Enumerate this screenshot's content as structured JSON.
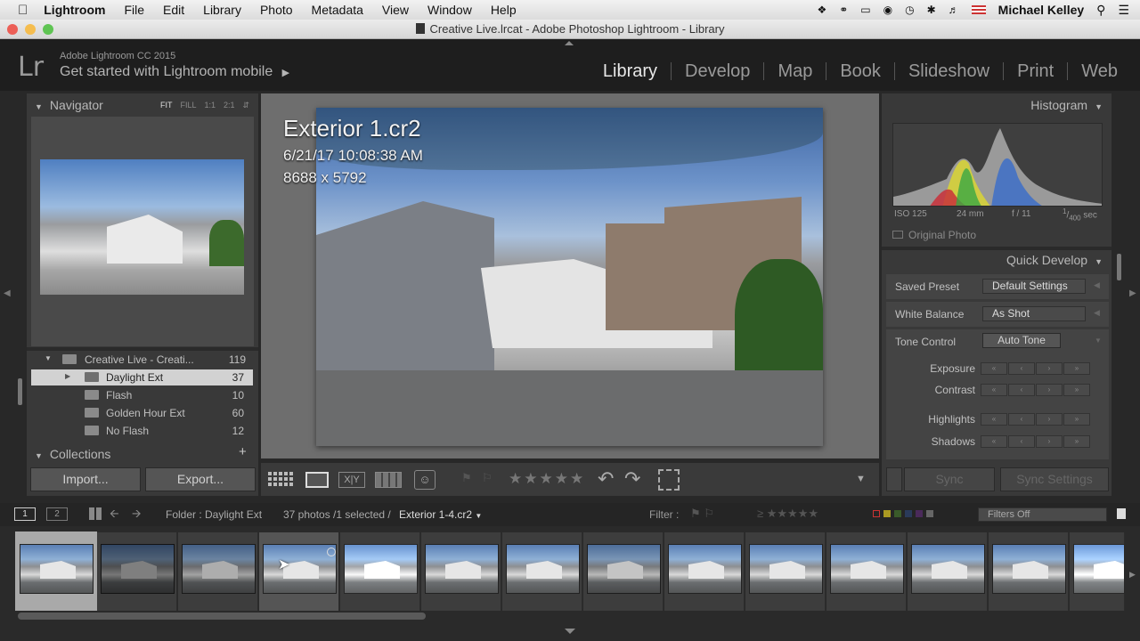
{
  "menubar": {
    "app": "Lightroom",
    "items": [
      "File",
      "Edit",
      "Library",
      "Photo",
      "Metadata",
      "View",
      "Window",
      "Help"
    ],
    "user": "Michael Kelley"
  },
  "window": {
    "title": "Creative Live.lrcat - Adobe Photoshop Lightroom - Library"
  },
  "identity": {
    "logo": "Lr",
    "line1": "Adobe Lightroom CC 2015",
    "line2": "Get started with Lightroom mobile"
  },
  "modules": [
    "Library",
    "Develop",
    "Map",
    "Book",
    "Slideshow",
    "Print",
    "Web"
  ],
  "navigator": {
    "title": "Navigator",
    "zooms": [
      "FIT",
      "FILL",
      "1:1",
      "2:1"
    ]
  },
  "folders": [
    {
      "name": "Creative Live - Creati...",
      "count": "119"
    },
    {
      "name": "Daylight Ext",
      "count": "37"
    },
    {
      "name": "Flash",
      "count": "10"
    },
    {
      "name": "Golden Hour Ext",
      "count": "60"
    },
    {
      "name": "No Flash",
      "count": "12"
    }
  ],
  "collections": {
    "title": "Collections"
  },
  "buttons": {
    "import": "Import...",
    "export": "Export...",
    "sync": "Sync",
    "sync_settings": "Sync Settings"
  },
  "photo": {
    "name": "Exterior 1.cr2",
    "date": "6/21/17 10:08:38 AM",
    "dims": "8688 x 5792"
  },
  "histogram": {
    "title": "Histogram",
    "iso": "ISO 125",
    "focal": "24 mm",
    "aperture": "f / 11",
    "shutter_num": "1",
    "shutter_den": "400",
    "shutter_unit": "sec",
    "original": "Original Photo"
  },
  "quick_develop": {
    "title": "Quick Develop",
    "saved_preset_label": "Saved Preset",
    "saved_preset_value": "Default Settings",
    "wb_label": "White Balance",
    "wb_value": "As Shot",
    "tone_label": "Tone Control",
    "auto_tone": "Auto Tone",
    "rows": [
      "Exposure",
      "Contrast",
      "Highlights",
      "Shadows"
    ]
  },
  "filmstrip_bar": {
    "page1": "1",
    "page2": "2",
    "folder": "Folder : Daylight Ext",
    "count": "37 photos /1 selected /",
    "current": "Exterior 1-4.cr2",
    "filter_label": "Filter :",
    "filters_off": "Filters Off"
  }
}
